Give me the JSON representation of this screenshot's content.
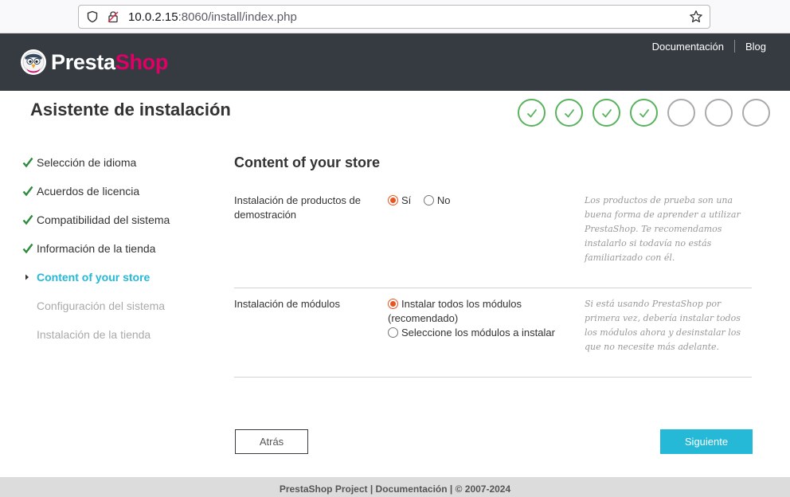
{
  "browser": {
    "url_host": "10.0.2.15",
    "url_rest": ":8060/install/index.php"
  },
  "header": {
    "logo_presta": "Presta",
    "logo_shop": "Shop",
    "links": [
      "Documentación",
      "Blog"
    ]
  },
  "page": {
    "title": "Asistente de instalación"
  },
  "progress": {
    "total_steps": 7,
    "completed_steps": 4,
    "accent_color": "#59b25e"
  },
  "sidebar": {
    "items": [
      {
        "label": "Selección de idioma",
        "state": "done"
      },
      {
        "label": "Acuerdos de licencia",
        "state": "done"
      },
      {
        "label": "Compatibilidad del sistema",
        "state": "done"
      },
      {
        "label": "Información de la tienda",
        "state": "done"
      },
      {
        "label": "Content of your store",
        "state": "active"
      },
      {
        "label": "Configuración del sistema",
        "state": "pending"
      },
      {
        "label": "Instalación de la tienda",
        "state": "pending"
      }
    ]
  },
  "main": {
    "section_title": "Content of your store",
    "demo": {
      "label": "Instalación de productos de demostración",
      "option_yes": "Sí",
      "option_no": "No",
      "selected": "yes",
      "help": "Los productos de prueba son una buena forma de aprender a utilizar PrestaShop. Te recomendamos instalarlo si todavía no estás familiarizado con él."
    },
    "modules": {
      "label": "Instalación de módulos",
      "option_all": "Instalar todos los módulos (recomendado)",
      "option_select": "Seleccione los módulos a instalar",
      "selected": "all",
      "help": "Si está usando PrestaShop por primera vez, debería instalar todos los módulos ahora y desinstalar los que no necesite más adelante."
    }
  },
  "buttons": {
    "back": "Atrás",
    "next": "Siguiente"
  },
  "footer": {
    "text": "PrestaShop Project | Documentación | © 2007-2024"
  },
  "colors": {
    "header_bg": "#363a41",
    "brand_pink": "#df0067",
    "active_blue": "#25b9d7",
    "radio_accent": "#e95420"
  }
}
